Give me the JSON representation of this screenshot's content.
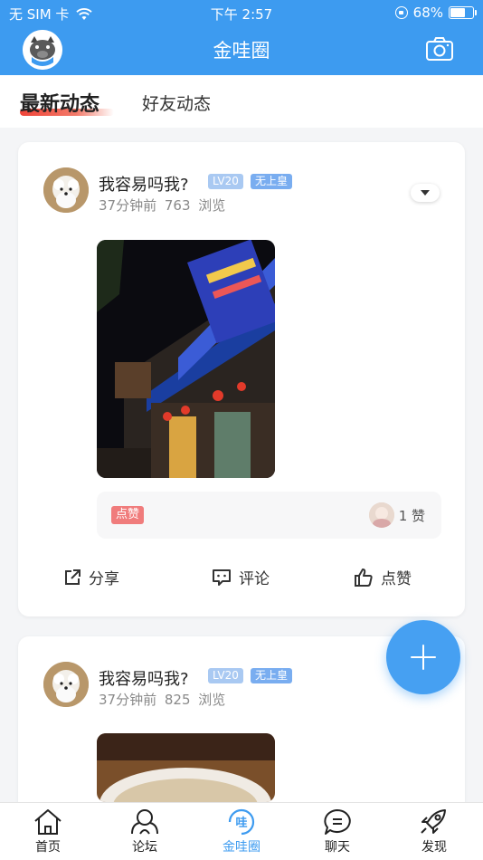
{
  "status_bar": {
    "carrier": "无 SIM 卡",
    "time": "下午 2:57",
    "battery": "68%",
    "battery_level": 0.68
  },
  "nav": {
    "title": "金哇圈"
  },
  "tabs": {
    "active": "最新动态",
    "other": "好友动态"
  },
  "posts": [
    {
      "author": "我容易吗我?",
      "level": "LV20",
      "title_badge": "无上皇",
      "time": "37分钟前",
      "views": "763 浏览",
      "like_tag": "点赞",
      "like_count": "1 赞",
      "actions": {
        "share": "分享",
        "comment": "评论",
        "like": "点赞"
      }
    },
    {
      "author": "我容易吗我?",
      "level": "LV20",
      "title_badge": "无上皇",
      "time": "37分钟前",
      "views": "825 浏览"
    }
  ],
  "bottom_nav": [
    {
      "label": "首页",
      "icon": "home-icon"
    },
    {
      "label": "论坛",
      "icon": "forum-icon"
    },
    {
      "label": "金哇圈",
      "icon": "wa-circle-icon",
      "active": true
    },
    {
      "label": "聊天",
      "icon": "chat-icon"
    },
    {
      "label": "发现",
      "icon": "rocket-icon"
    }
  ],
  "colors": {
    "primary": "#3d9bf0",
    "accent_red": "#f04438",
    "like_tag": "#f07c7c"
  }
}
